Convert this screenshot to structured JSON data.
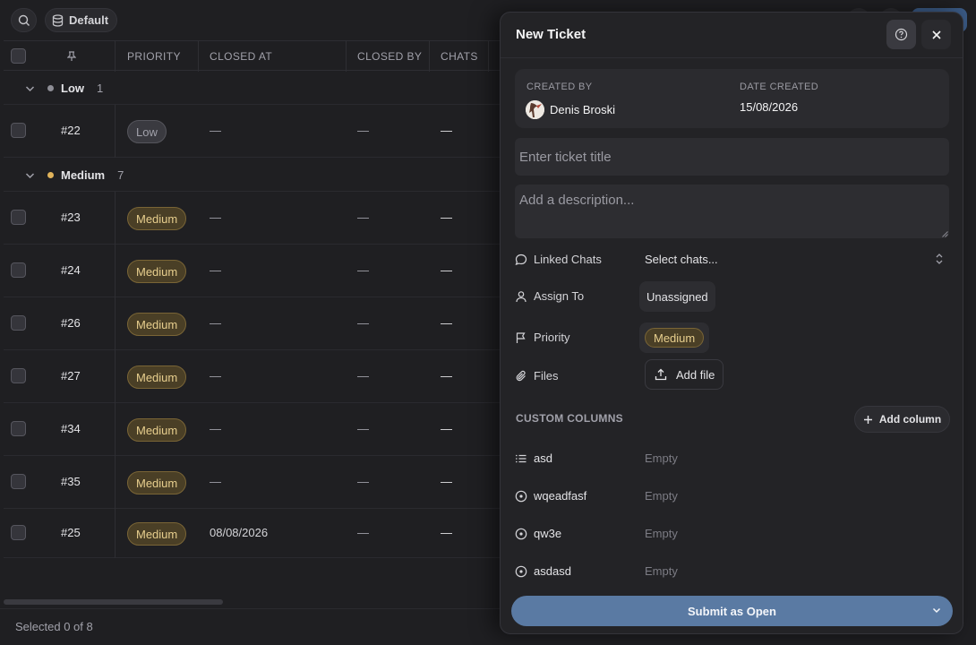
{
  "toolbar": {
    "view_name": "Default",
    "search_icon": "search-icon",
    "view_icon": "database-icon"
  },
  "table": {
    "columns": {
      "pin": "pin-icon",
      "priority": "PRIORITY",
      "closed_at": "CLOSED AT",
      "closed_by": "CLOSED BY",
      "chats": "CHATS"
    },
    "groups": [
      {
        "label": "Low",
        "count": "1",
        "color": "#8e8e96"
      },
      {
        "label": "Medium",
        "count": "7",
        "color": "#e0b35a"
      }
    ],
    "rows": [
      {
        "id": "#22",
        "priority": "Low",
        "closed_at": "—",
        "closed_by": "—",
        "chats": "—"
      },
      {
        "id": "#23",
        "priority": "Medium",
        "closed_at": "—",
        "closed_by": "—",
        "chats": "—"
      },
      {
        "id": "#24",
        "priority": "Medium",
        "closed_at": "—",
        "closed_by": "—",
        "chats": "—"
      },
      {
        "id": "#26",
        "priority": "Medium",
        "closed_at": "—",
        "closed_by": "—",
        "chats": "—"
      },
      {
        "id": "#27",
        "priority": "Medium",
        "closed_at": "—",
        "closed_by": "—",
        "chats": "—"
      },
      {
        "id": "#34",
        "priority": "Medium",
        "closed_at": "—",
        "closed_by": "—",
        "chats": "—"
      },
      {
        "id": "#35",
        "priority": "Medium",
        "closed_at": "—",
        "closed_by": "—",
        "chats": "—"
      },
      {
        "id": "#25",
        "priority": "Medium",
        "closed_at": "08/08/2026",
        "closed_by": "—",
        "chats": "—"
      }
    ],
    "footer": "Selected 0 of 8"
  },
  "modal": {
    "title": "New Ticket",
    "created_by_label": "CREATED BY",
    "created_by_value": "Denis Broski",
    "date_created_label": "DATE CREATED",
    "date_created_value": "15/08/2026",
    "title_placeholder": "Enter ticket title",
    "description_placeholder": "Add a description...",
    "linked_chats_label": "Linked Chats",
    "linked_chats_value": "Select chats...",
    "assign_to_label": "Assign To",
    "assign_to_value": "Unassigned",
    "priority_label": "Priority",
    "priority_value": "Medium",
    "files_label": "Files",
    "add_file_label": "Add file",
    "custom_columns_header": "CUSTOM COLUMNS",
    "add_column_label": "Add column",
    "custom_columns": [
      {
        "name": "asd",
        "value": "Empty",
        "icon": "list-icon"
      },
      {
        "name": "wqeadfasf",
        "value": "Empty",
        "icon": "circle-dot-icon"
      },
      {
        "name": "qw3e",
        "value": "Empty",
        "icon": "circle-dot-icon"
      },
      {
        "name": "asdasd",
        "value": "Empty",
        "icon": "circle-dot-icon"
      }
    ],
    "submit_label": "Submit as Open"
  },
  "colors": {
    "accent": "#5a7aa3",
    "medium_badge": "#e8cf8e",
    "background": "#1f1f22",
    "panel": "#232326"
  }
}
